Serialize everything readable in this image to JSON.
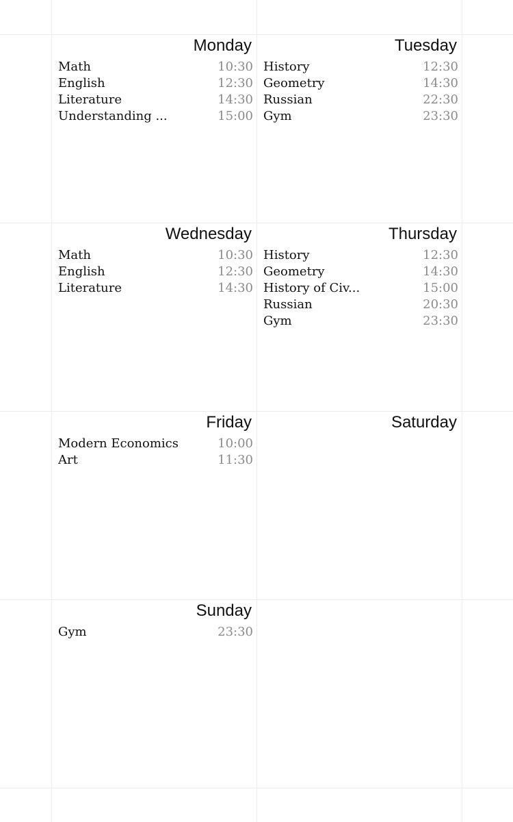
{
  "days": [
    {
      "name": "Monday",
      "events": [
        {
          "subject": "Math",
          "time": "10:30"
        },
        {
          "subject": "English",
          "time": "12:30"
        },
        {
          "subject": "Literature",
          "time": "14:30"
        },
        {
          "subject": "Understanding ...",
          "time": "15:00"
        }
      ]
    },
    {
      "name": "Tuesday",
      "events": [
        {
          "subject": "History",
          "time": "12:30"
        },
        {
          "subject": "Geometry",
          "time": "14:30"
        },
        {
          "subject": "Russian",
          "time": "22:30"
        },
        {
          "subject": "Gym",
          "time": "23:30"
        }
      ]
    },
    {
      "name": "Wednesday",
      "events": [
        {
          "subject": "Math",
          "time": "10:30"
        },
        {
          "subject": "English",
          "time": "12:30"
        },
        {
          "subject": "Literature",
          "time": "14:30"
        }
      ]
    },
    {
      "name": "Thursday",
      "events": [
        {
          "subject": "History",
          "time": "12:30"
        },
        {
          "subject": "Geometry",
          "time": "14:30"
        },
        {
          "subject": "History of Civ...",
          "time": "15:00"
        },
        {
          "subject": "Russian",
          "time": "20:30"
        },
        {
          "subject": "Gym",
          "time": "23:30"
        }
      ]
    },
    {
      "name": "Friday",
      "events": [
        {
          "subject": "Modern Economics",
          "time": "10:00"
        },
        {
          "subject": "Art",
          "time": "11:30"
        }
      ]
    },
    {
      "name": "Saturday",
      "events": []
    },
    {
      "name": "Sunday",
      "events": [
        {
          "subject": "Gym",
          "time": "23:30"
        }
      ]
    }
  ]
}
